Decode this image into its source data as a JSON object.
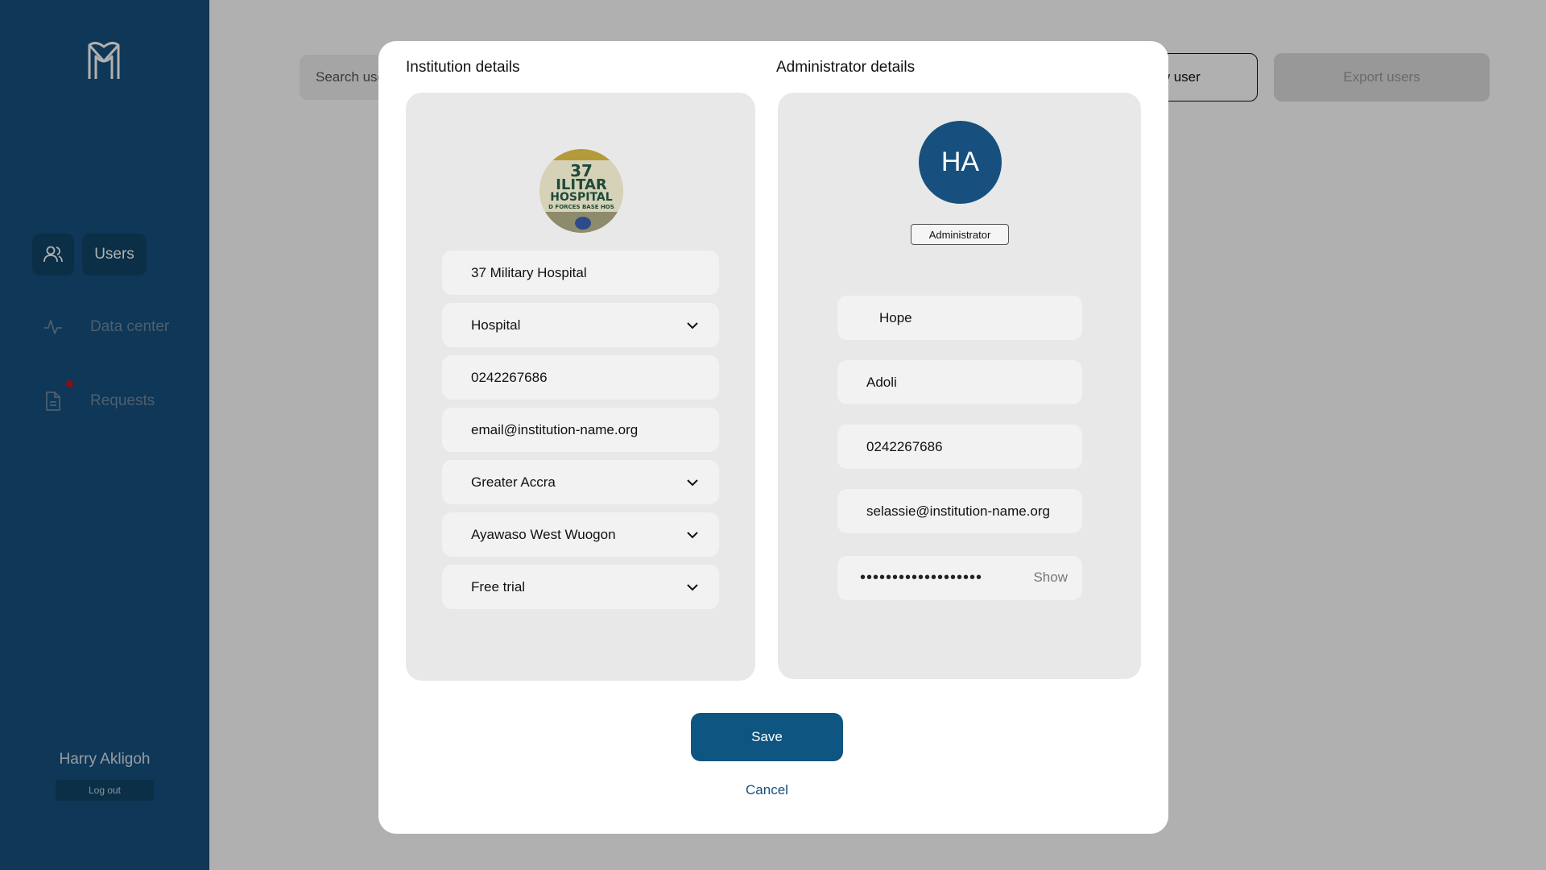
{
  "sidebar": {
    "nav": {
      "users": "Users",
      "data_center": "Data center",
      "requests": "Requests"
    },
    "user_name": "Harry Akligoh",
    "logout": "Log out"
  },
  "toolbar": {
    "search_placeholder": "Search use",
    "new_user": "ew user",
    "export_users": "Export users"
  },
  "modal": {
    "institution_title": "Institution details",
    "admin_title": "Administrator details",
    "institution": {
      "logo_text_line1": "37",
      "logo_text_line2": "ILITAR",
      "logo_text_line3": "HOSPITAL",
      "logo_text_line4": "D FORCES BASE HOS",
      "name": "37 Military Hospital",
      "type": "Hospital",
      "phone": "0242267686",
      "email": "email@institution-name.org",
      "region": "Greater Accra",
      "district": "Ayawaso West Wuogon",
      "plan": "Free trial"
    },
    "admin": {
      "initials": "HA",
      "role": "Administrator",
      "first_name": "Hope",
      "last_name": "Adoli",
      "phone": "0242267686",
      "email": "selassie@institution-name.org",
      "password_mask": "•••••••••••••••••••",
      "show_label": "Show"
    },
    "save": "Save",
    "cancel": "Cancel"
  },
  "colors": {
    "brand": "#17507e",
    "button": "#0e5581",
    "notification_dot": "#c0182a"
  }
}
